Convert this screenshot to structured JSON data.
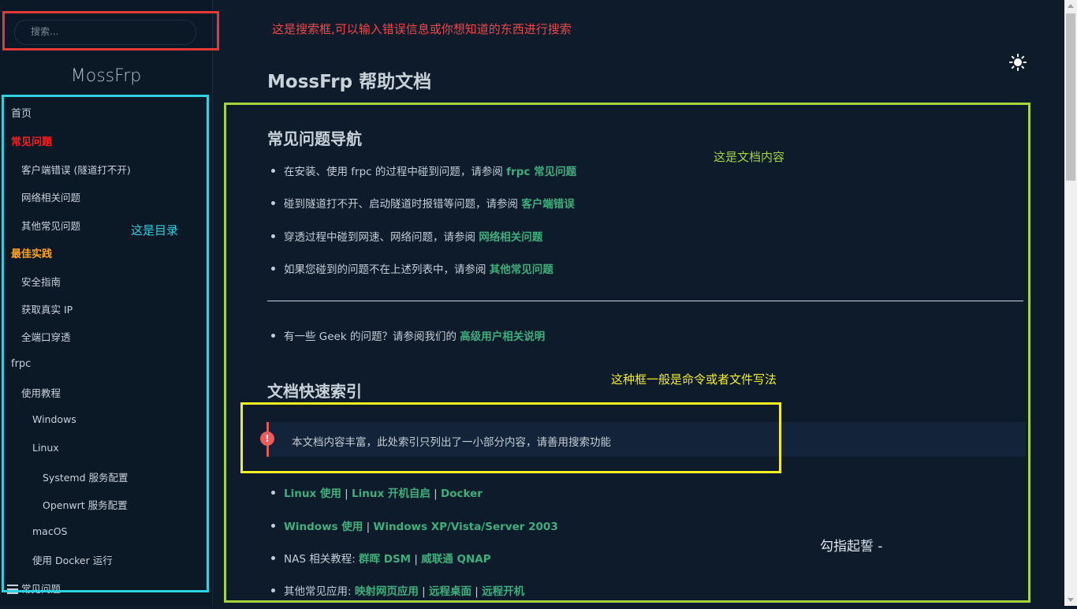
{
  "search": {
    "placeholder": "搜索..."
  },
  "brand": "MossFrp",
  "sidebar": {
    "items": [
      {
        "label": "首页"
      },
      {
        "label": "常见问题"
      },
      {
        "label": "客户端错误 (隧道打不开)"
      },
      {
        "label": "网络相关问题"
      },
      {
        "label": "其他常见问题"
      },
      {
        "label": "最佳实践"
      },
      {
        "label": "安全指南"
      },
      {
        "label": "获取真实 IP"
      },
      {
        "label": "全端口穿透"
      },
      {
        "label": "frpc"
      },
      {
        "label": "使用教程"
      },
      {
        "label": "Windows"
      },
      {
        "label": "Linux"
      },
      {
        "label": "Systemd 服务配置"
      },
      {
        "label": "Openwrt 服务配置"
      },
      {
        "label": "macOS"
      },
      {
        "label": "使用 Docker 运行"
      },
      {
        "label": "常见问题"
      }
    ]
  },
  "annotations": {
    "search": "这是搜索框,可以输入错误信息或你想知道的东西进行搜索",
    "toc": "这是目录",
    "content": "这是文档内容",
    "code": "这种框一般是命令或者文件写法"
  },
  "main": {
    "title": "MossFrp 帮助文档",
    "nav_section": {
      "title": "常见问题导航",
      "items": [
        {
          "text": "在安装、使用 frpc 的过程中碰到问题，请参阅 ",
          "link": "frpc 常见问题"
        },
        {
          "text": "碰到隧道打不开、启动隧道时报错等问题，请参阅 ",
          "link": "客户端错误"
        },
        {
          "text": "穿透过程中碰到网速、网络问题，请参阅 ",
          "link": "网络相关问题"
        },
        {
          "text": "如果您碰到的问题不在上述列表中，请参阅 ",
          "link": "其他常见问题"
        }
      ],
      "geek": {
        "text": "有一些 Geek 的问题？请参阅我们的 ",
        "link": "高级用户相关说明"
      }
    },
    "index_section": {
      "title": "文档快速索引",
      "tip": "本文档内容丰富，此处索引只列出了一小部分内容，请善用搜索功能",
      "row1": {
        "a": "Linux 使用",
        "b": "Linux 开机自启",
        "c": "Docker"
      },
      "row2": {
        "a": "Windows 使用",
        "b": "Windows XP/Vista/Server 2003"
      },
      "row3": {
        "prefix": "NAS 相关教程: ",
        "a": "群晖 DSM",
        "b": "威联通 QNAP"
      },
      "row4": {
        "prefix": "其他常见应用: ",
        "a": "映射网页应用",
        "b": "远程桌面",
        "c": "远程开机"
      }
    },
    "floating_text": "勾指起誓 -"
  },
  "colors": {
    "background": "#0d1b2a",
    "link": "#3eaf7c",
    "faq_heading": "#ff1e1e",
    "best_practice_heading": "#ffa31a",
    "annotation_red": "#e53935",
    "annotation_cyan": "#2fd0df",
    "annotation_green": "#a7d33a",
    "annotation_yellow": "#f2ee22"
  }
}
